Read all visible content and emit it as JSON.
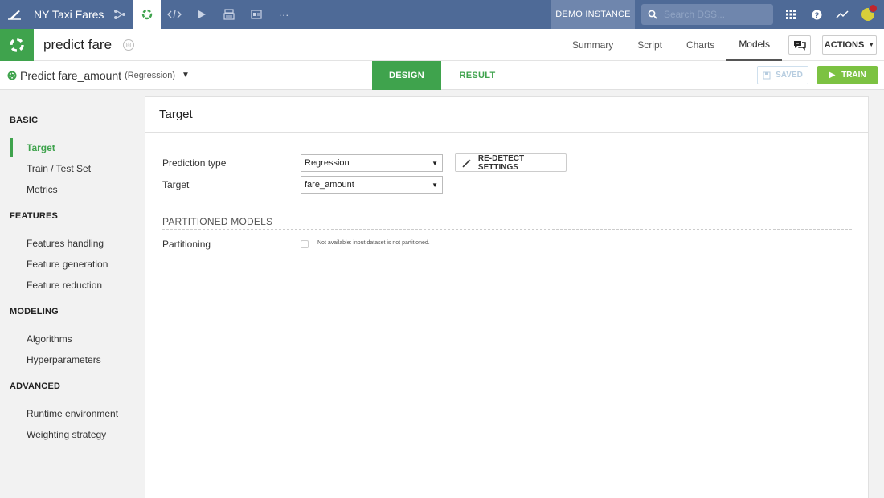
{
  "topbar": {
    "project_title": "NY Taxi Fares",
    "icons": [
      "flow-icon",
      "ml-icon",
      "code-icon",
      "run-icon",
      "notebook-icon",
      "dashboard-icon",
      "more-icon"
    ],
    "more_label": "···",
    "demo_label": "DEMO INSTANCE",
    "search_placeholder": "Search DSS..."
  },
  "object": {
    "name": "predict fare",
    "nav": [
      "Summary",
      "Script",
      "Charts",
      "Models"
    ],
    "active_nav": "Models",
    "actions_label": "ACTIONS"
  },
  "design": {
    "task_title": "Predict fare_amount",
    "task_type": "(Regression)",
    "tab_design": "DESIGN",
    "tab_result": "RESULT",
    "saved_label": "SAVED",
    "train_label": "TRAIN"
  },
  "sidebar": {
    "sections": [
      {
        "title": "BASIC",
        "items": [
          "Target",
          "Train / Test Set",
          "Metrics"
        ]
      },
      {
        "title": "FEATURES",
        "items": [
          "Features handling",
          "Feature generation",
          "Feature reduction"
        ]
      },
      {
        "title": "MODELING",
        "items": [
          "Algorithms",
          "Hyperparameters"
        ]
      },
      {
        "title": "ADVANCED",
        "items": [
          "Runtime environment",
          "Weighting strategy"
        ]
      }
    ],
    "active_item": "Target"
  },
  "panel": {
    "title": "Target",
    "prediction_type_label": "Prediction type",
    "prediction_type_value": "Regression",
    "target_label": "Target",
    "target_value": "fare_amount",
    "redetect_label": "RE-DETECT SETTINGS",
    "partitioned_title": "PARTITIONED MODELS",
    "partitioning_label": "Partitioning",
    "partitioning_note": "Not available: input dataset is not partitioned."
  },
  "colors": {
    "topbar": "#4e6a97",
    "accent_green": "#3fa34d",
    "train_green": "#7cc242"
  }
}
